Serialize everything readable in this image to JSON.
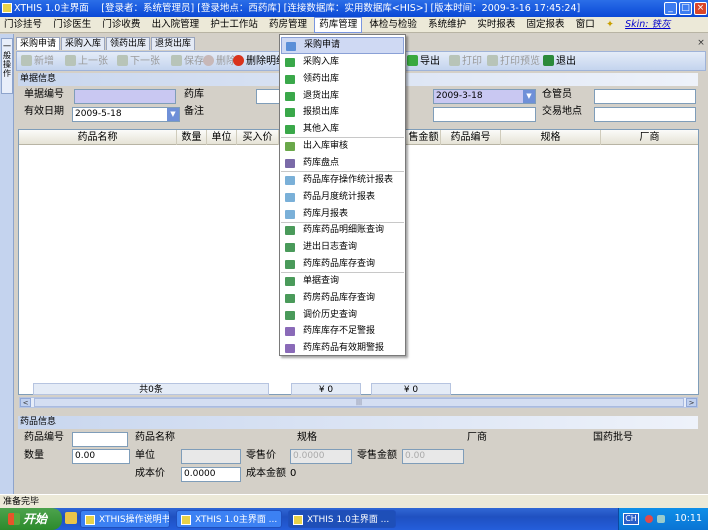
{
  "window": {
    "title": "XTHIS 1.0主界面 　[登录者：系统管理员] [登录地点：西药库] [连接数据库：实用数据库<HIS>] [版本时间：2009-3-16 17:45:24]",
    "min": "_",
    "max": "□",
    "close": "×"
  },
  "menu": {
    "items": [
      "门诊挂号",
      "门诊医生",
      "门诊收费",
      "出入院管理",
      "护士工作站",
      "药房管理",
      "药库管理",
      "体检与检验",
      "系统维护",
      "实时报表",
      "固定报表",
      "窗口"
    ],
    "skin": "Skin: 铁灰"
  },
  "sidebar": {
    "tab": "一般操作"
  },
  "tabs": [
    "采购申请",
    "采购入库",
    "领药出库",
    "退货出库"
  ],
  "tab_close": "×",
  "toolbar": {
    "add": "新增",
    "prev": "上一张",
    "next": "下一张",
    "edit": "修改",
    "save": "保存",
    "del": "删除",
    "del_detail": "删除明细",
    "export": "导出",
    "print": "打印",
    "preview": "打印预览",
    "exit": "退出"
  },
  "form": {
    "section": "单据信息",
    "doc_no_label": "单据编号",
    "doc_no": "",
    "warehouse_label": "药库",
    "date_value": "2009-3-18",
    "keeper_label": "仓管员",
    "valid_label": "有效日期",
    "valid_value": "2009-5-18",
    "remark_label": "备注",
    "trade_label": "交易地点"
  },
  "grid": {
    "columns": [
      "药品名称",
      "数量",
      "单位",
      "买入价",
      "售金额",
      "药品编号",
      "规格",
      "厂商"
    ],
    "footer_count": "共0条",
    "footer_amount1": "¥ 0",
    "footer_amount2": "¥ 0",
    "left_arrow": "<",
    "right_arrow": ">",
    "thumb": "|||"
  },
  "drug": {
    "section": "药品信息",
    "code_label": "药品编号",
    "code": "",
    "name_label": "药品名称",
    "spec_label": "规格",
    "maker_label": "厂商",
    "approval_label": "国药批号",
    "qty_label": "数量",
    "qty": "0.00",
    "unit_label": "单位",
    "unit": "",
    "retail_label": "零售价",
    "retail": "0.0000",
    "retail_amt_label": "零售金额",
    "retail_amt": "0.00",
    "cost_label": "成本价",
    "cost": "0.0000",
    "cost_amt_label": "成本金额",
    "cost_amt": "0"
  },
  "dropdown": {
    "items": [
      "采购申请",
      "采购入库",
      "领药出库",
      "退货出库",
      "报损出库",
      "其他入库",
      "出入库审核",
      "药库盘点",
      "药品库存操作统计报表",
      "药品月度统计报表",
      "药库月报表",
      "药库药品明细账查询",
      "进出日志查询",
      "药库药品库存查询",
      "单据查询",
      "药房药品库存查询",
      "调价历史查询",
      "药库库存不足警报",
      "药库药品有效期警报"
    ]
  },
  "status": "准备完毕",
  "taskbar": {
    "start": "开始",
    "tasks": [
      "XTHIS操作说明书.d...",
      "XTHIS 1.0主界面 ...",
      "XTHIS 1.0主界面 ..."
    ],
    "lang": "CH",
    "time": "10:11"
  },
  "colors": {
    "accent": "#0a48d6",
    "highlight": "#cfd9f3",
    "field_lavender": "#c9c8f2"
  }
}
